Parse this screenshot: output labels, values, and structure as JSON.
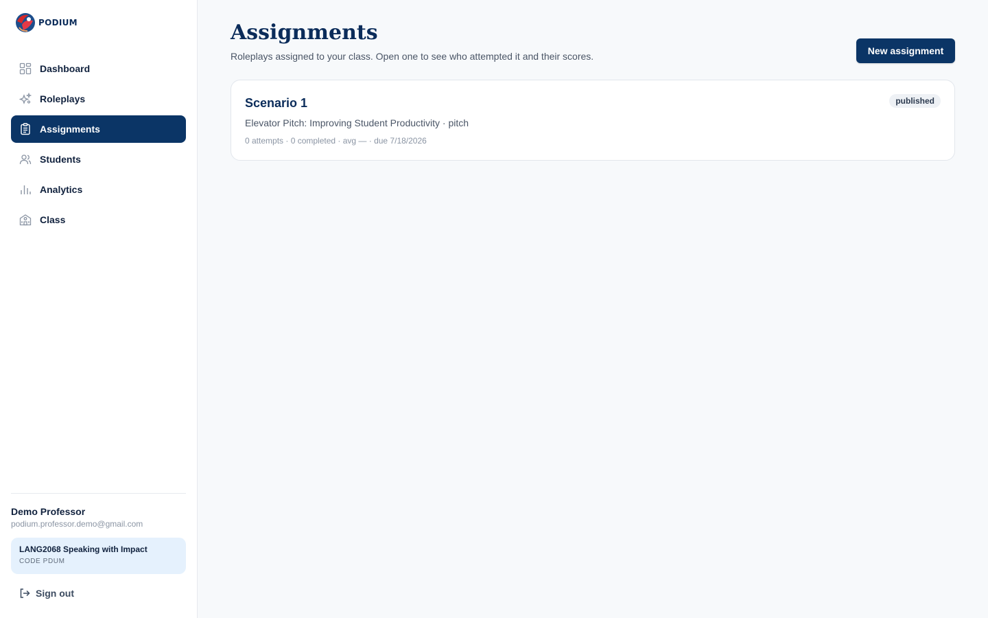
{
  "app": {
    "logo_text": "PODIUM"
  },
  "sidebar": {
    "items": [
      {
        "label": "Dashboard",
        "icon": "dashboard-icon"
      },
      {
        "label": "Roleplays",
        "icon": "sparkles-icon"
      },
      {
        "label": "Assignments",
        "icon": "clipboard-icon",
        "active": true
      },
      {
        "label": "Students",
        "icon": "users-icon"
      },
      {
        "label": "Analytics",
        "icon": "bar-chart-icon"
      },
      {
        "label": "Class",
        "icon": "school-icon"
      }
    ],
    "user": {
      "name": "Demo Professor",
      "email": "podium.professor.demo@gmail.com"
    },
    "class": {
      "name": "LANG2068 Speaking with Impact",
      "code": "CODE PDUM"
    },
    "signout_label": "Sign out"
  },
  "main": {
    "title": "Assignments",
    "subtitle": "Roleplays assigned to your class. Open one to see who attempted it and their scores.",
    "new_button_label": "New assignment",
    "assignments": [
      {
        "title": "Scenario 1",
        "description": "Elevator Pitch: Improving Student Productivity · pitch",
        "meta": "0 attempts · 0 completed · avg — · due 7/18/2026",
        "status": "published"
      }
    ]
  },
  "colors": {
    "accent": "#0b3566",
    "class_card_bg": "#e5f1fd",
    "background": "#f7f9fb"
  }
}
